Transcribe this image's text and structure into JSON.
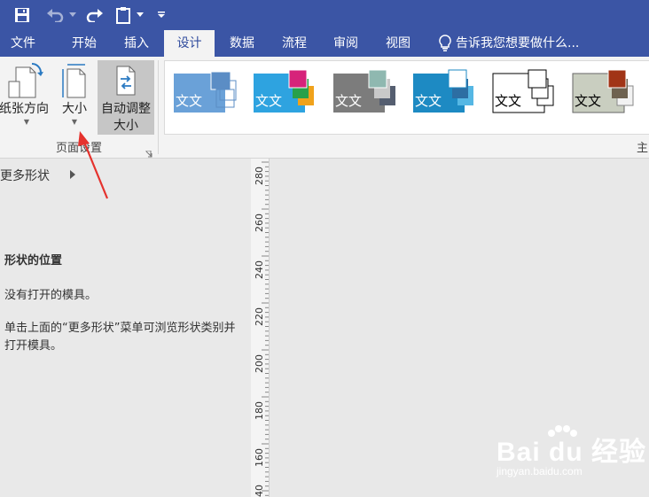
{
  "title_bar": {
    "icons": [
      "save-icon",
      "undo-icon",
      "redo-icon",
      "clipboard-icon",
      "customize-arrow-icon"
    ]
  },
  "tabs": [
    "文件",
    "开始",
    "插入",
    "设计",
    "数据",
    "流程",
    "审阅",
    "视图"
  ],
  "active_tab": "设计",
  "tell_me": "告诉我您想要做什么...",
  "ribbon": {
    "orientation_label": "纸张方向",
    "size_label": "大小",
    "autosize_label_line1": "自动调整",
    "autosize_label_line2": "大小",
    "group_label": "页面设置",
    "next_group_label": "主"
  },
  "themes": [
    {
      "text": "文文",
      "bg": "#6aa1d8",
      "fg": "#ffffff",
      "accent": "#5b8dc5"
    },
    {
      "text": "文文",
      "bg": "#2ea3e0",
      "fg": "#ffffff",
      "accent": "#d6237a"
    },
    {
      "text": "文文",
      "bg": "#7c7c7c",
      "fg": "#ffffff",
      "accent": "#8fb8b0"
    },
    {
      "text": "文文",
      "bg": "#1d8ac3",
      "fg": "#ffffff",
      "accent": "#ffffff"
    },
    {
      "text": "文文",
      "bg": "#ffffff",
      "fg": "#000000",
      "accent": "#ffffff"
    },
    {
      "text": "文文",
      "bg": "#c9cec0",
      "fg": "#000000",
      "accent": "#a13416"
    }
  ],
  "shapes_pane": {
    "more_shapes": "更多形状",
    "section_title": "形状的位置",
    "no_stencils": "没有打开的模具。",
    "hint": "单击上面的“更多形状”菜单可浏览形状类别并打开模具。"
  },
  "ruler_labels": [
    "280",
    "260",
    "240",
    "220",
    "200",
    "180",
    "160",
    "40"
  ],
  "watermark": {
    "brand": "Bai du 经验",
    "url": "jingyan.baidu.com"
  },
  "colors": {
    "title_bar": "#3b55a5",
    "ribbon": "#f3f3f3",
    "annotation_arrow": "#e5322d"
  }
}
